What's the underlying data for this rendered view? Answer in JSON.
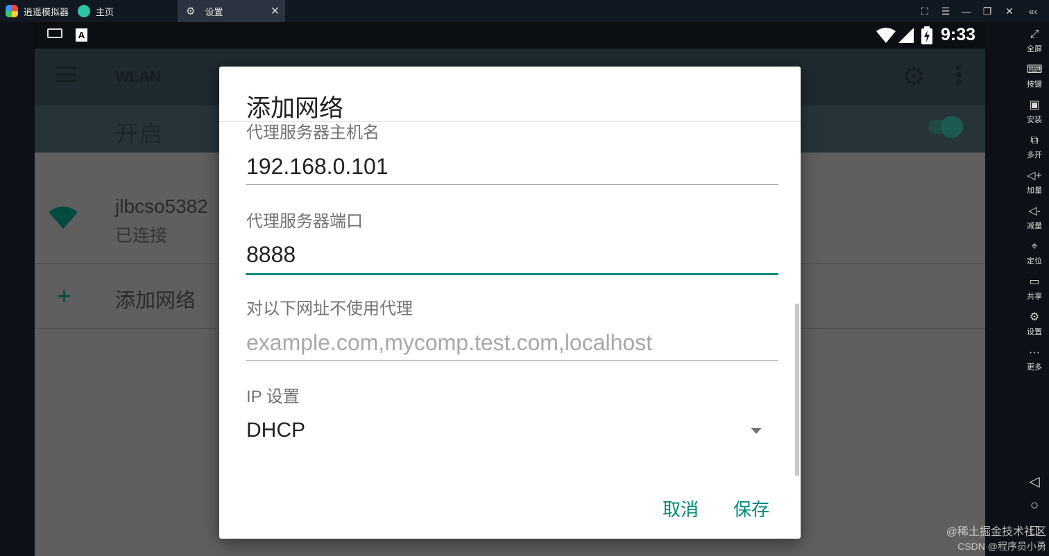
{
  "titlebar": {
    "app_name": "逍遥模拟器",
    "tabs": [
      {
        "label": "主页"
      },
      {
        "label": "设置"
      }
    ],
    "close_tab": "✕"
  },
  "statusbar": {
    "time": "9:33"
  },
  "settings": {
    "title": "WLAN",
    "switch_label": "开启",
    "network_name": "jlbcso5382",
    "network_status": "已连接",
    "add_network": "添加网络"
  },
  "dialog": {
    "title": "添加网络",
    "proxy_host_label": "代理服务器主机名",
    "proxy_host_value": "192.168.0.101",
    "proxy_port_label": "代理服务器端口",
    "proxy_port_value": "8888",
    "bypass_label": "对以下网址不使用代理",
    "bypass_placeholder": "example.com,mycomp.test.com,localhost",
    "ip_label": "IP 设置",
    "ip_value": "DHCP",
    "cancel": "取消",
    "save": "保存"
  },
  "toolbar": {
    "items": [
      {
        "label": "全屏",
        "icon": "fullscreen-icon"
      },
      {
        "label": "按键",
        "icon": "keyboard-icon"
      },
      {
        "label": "安装",
        "icon": "apk-icon"
      },
      {
        "label": "多开",
        "icon": "multi-instance-icon"
      },
      {
        "label": "加量",
        "icon": "volume-up-icon"
      },
      {
        "label": "减量",
        "icon": "volume-down-icon"
      },
      {
        "label": "定位",
        "icon": "location-icon"
      },
      {
        "label": "共享",
        "icon": "folder-icon"
      },
      {
        "label": "设置",
        "icon": "settings-icon"
      },
      {
        "label": "更多",
        "icon": "more-icon"
      }
    ]
  },
  "watermark": {
    "line1": "@稀土掘金技术社区",
    "line2": "CSDN @程序员小勇"
  },
  "colors": {
    "accent": "#00897b",
    "dialog_bg": "#ffffff",
    "emulator_bg": "#0d1117"
  }
}
